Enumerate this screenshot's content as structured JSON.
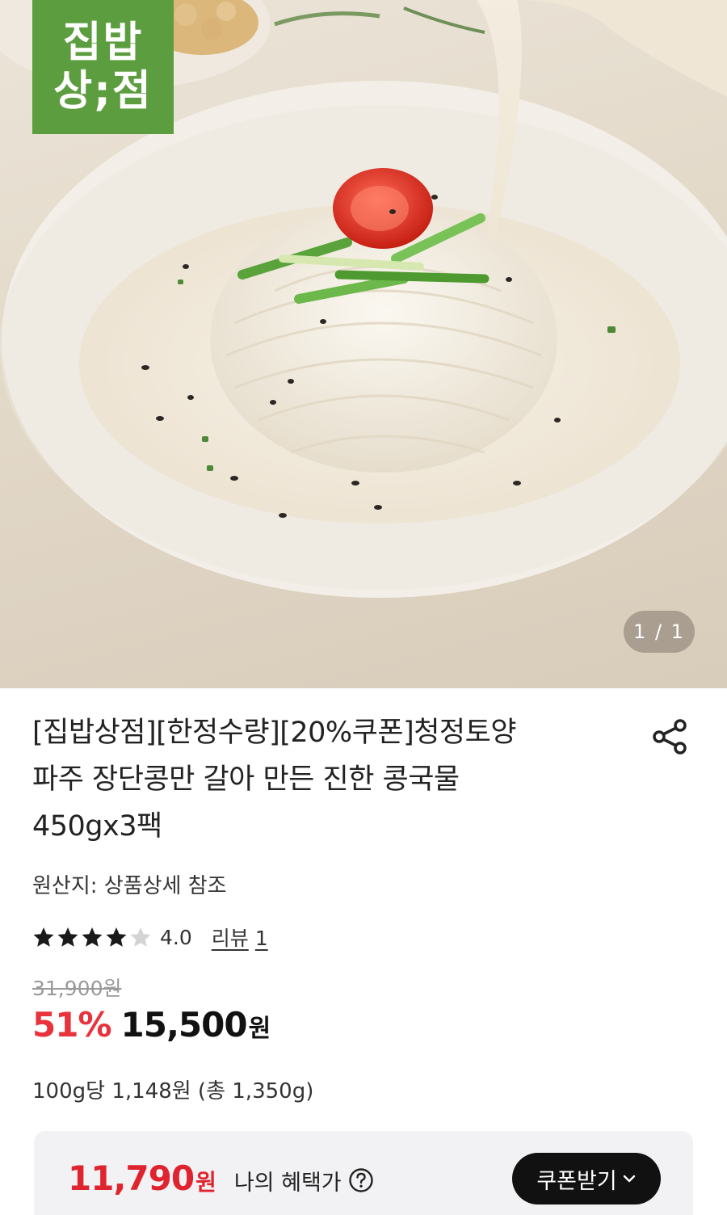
{
  "hero": {
    "brand_logo_line1": "집밥",
    "brand_logo_line2": "상;점",
    "pager": "1 / 1"
  },
  "product": {
    "title_line1": "[집밥상점][한정수량][20%쿠폰]청정토양",
    "title_line2": "파주 장단콩만 갈아 만든 진한 콩국물",
    "title_line3": "450gx3팩",
    "origin": "원산지: 상품상세 참조",
    "rating": 4.0,
    "rating_label": "4.0",
    "review_label": "리뷰",
    "review_count": "1",
    "original_price": "31,900원",
    "discount": "51%",
    "price": "15,500",
    "price_unit": "원",
    "unit_price": "100g당 1,148원 (총 1,350g)"
  },
  "coupon": {
    "benefit_amount": "11,790",
    "benefit_unit": "원",
    "benefit_label": "나의 혜택가",
    "button_label": "쿠폰받기"
  },
  "icons": {
    "share": "share-icon",
    "star": "star-icon",
    "help": "question-circle-icon",
    "chevron": "chevron-down-icon"
  },
  "colors": {
    "brand_green": "#5c9e3f",
    "discount_red": "#e8323c",
    "benefit_red": "#e0242f",
    "button_black": "#111111",
    "coupon_bg": "#f2f2f4"
  }
}
